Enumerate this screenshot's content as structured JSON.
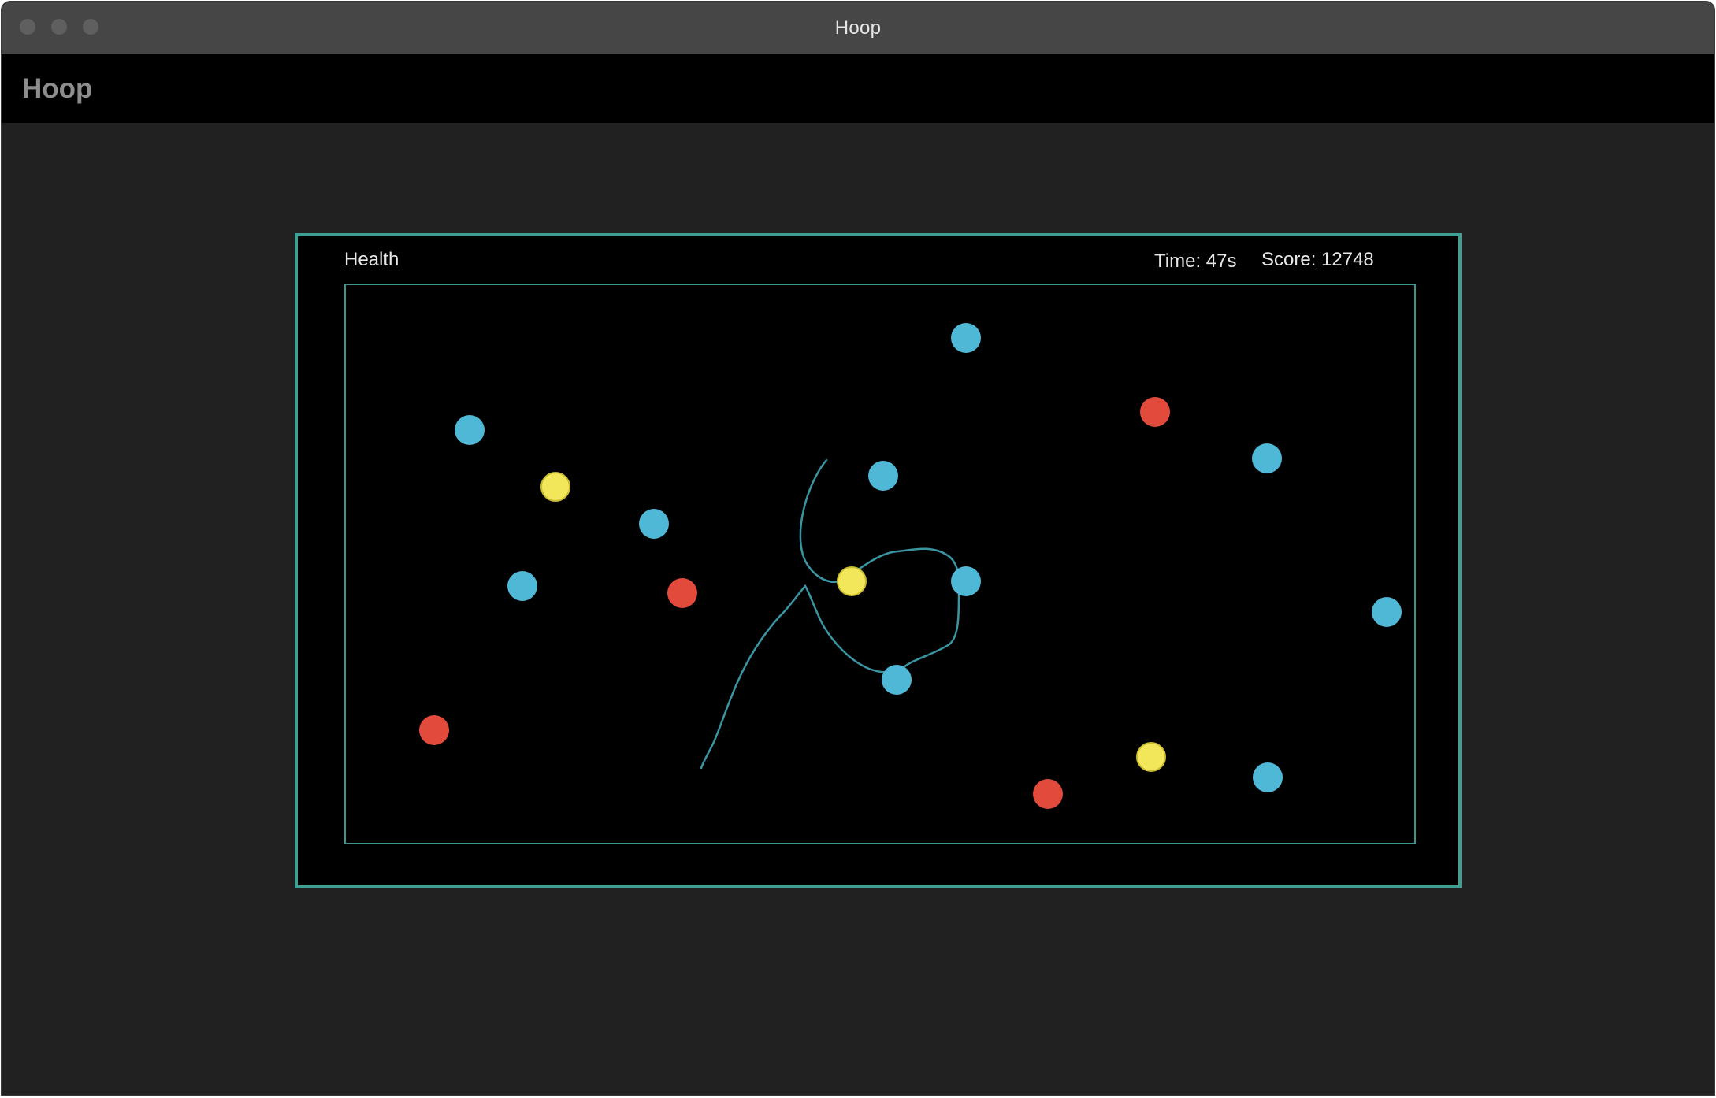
{
  "window": {
    "title": "Hoop"
  },
  "app": {
    "title": "Hoop"
  },
  "hud": {
    "health_label": "Health",
    "time_label": "Time: 47s",
    "score_label": "Score: 12748"
  },
  "colors": {
    "accent": "#3f9f93",
    "blue": "#4fb8d6",
    "red": "#e24b3c",
    "yellow": "#f2e65a",
    "trail": "#3a95a3"
  },
  "icons": {
    "close": "window-close-icon",
    "minimize": "window-minimize-icon",
    "maximize": "window-maximize-icon"
  }
}
